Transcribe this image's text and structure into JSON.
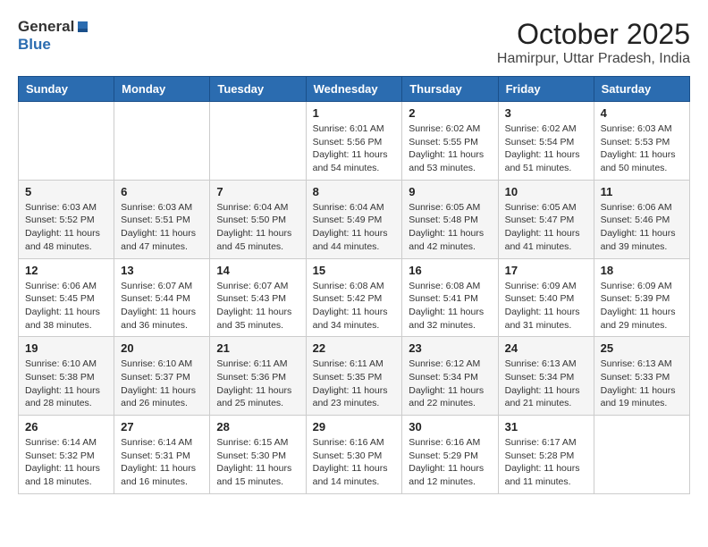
{
  "header": {
    "logo_general": "General",
    "logo_blue": "Blue",
    "month": "October 2025",
    "location": "Hamirpur, Uttar Pradesh, India"
  },
  "days_of_week": [
    "Sunday",
    "Monday",
    "Tuesday",
    "Wednesday",
    "Thursday",
    "Friday",
    "Saturday"
  ],
  "weeks": [
    {
      "days": [
        {
          "date": "",
          "info": ""
        },
        {
          "date": "",
          "info": ""
        },
        {
          "date": "",
          "info": ""
        },
        {
          "date": "1",
          "info": "Sunrise: 6:01 AM\nSunset: 5:56 PM\nDaylight: 11 hours and 54 minutes."
        },
        {
          "date": "2",
          "info": "Sunrise: 6:02 AM\nSunset: 5:55 PM\nDaylight: 11 hours and 53 minutes."
        },
        {
          "date": "3",
          "info": "Sunrise: 6:02 AM\nSunset: 5:54 PM\nDaylight: 11 hours and 51 minutes."
        },
        {
          "date": "4",
          "info": "Sunrise: 6:03 AM\nSunset: 5:53 PM\nDaylight: 11 hours and 50 minutes."
        }
      ]
    },
    {
      "days": [
        {
          "date": "5",
          "info": "Sunrise: 6:03 AM\nSunset: 5:52 PM\nDaylight: 11 hours and 48 minutes."
        },
        {
          "date": "6",
          "info": "Sunrise: 6:03 AM\nSunset: 5:51 PM\nDaylight: 11 hours and 47 minutes."
        },
        {
          "date": "7",
          "info": "Sunrise: 6:04 AM\nSunset: 5:50 PM\nDaylight: 11 hours and 45 minutes."
        },
        {
          "date": "8",
          "info": "Sunrise: 6:04 AM\nSunset: 5:49 PM\nDaylight: 11 hours and 44 minutes."
        },
        {
          "date": "9",
          "info": "Sunrise: 6:05 AM\nSunset: 5:48 PM\nDaylight: 11 hours and 42 minutes."
        },
        {
          "date": "10",
          "info": "Sunrise: 6:05 AM\nSunset: 5:47 PM\nDaylight: 11 hours and 41 minutes."
        },
        {
          "date": "11",
          "info": "Sunrise: 6:06 AM\nSunset: 5:46 PM\nDaylight: 11 hours and 39 minutes."
        }
      ]
    },
    {
      "days": [
        {
          "date": "12",
          "info": "Sunrise: 6:06 AM\nSunset: 5:45 PM\nDaylight: 11 hours and 38 minutes."
        },
        {
          "date": "13",
          "info": "Sunrise: 6:07 AM\nSunset: 5:44 PM\nDaylight: 11 hours and 36 minutes."
        },
        {
          "date": "14",
          "info": "Sunrise: 6:07 AM\nSunset: 5:43 PM\nDaylight: 11 hours and 35 minutes."
        },
        {
          "date": "15",
          "info": "Sunrise: 6:08 AM\nSunset: 5:42 PM\nDaylight: 11 hours and 34 minutes."
        },
        {
          "date": "16",
          "info": "Sunrise: 6:08 AM\nSunset: 5:41 PM\nDaylight: 11 hours and 32 minutes."
        },
        {
          "date": "17",
          "info": "Sunrise: 6:09 AM\nSunset: 5:40 PM\nDaylight: 11 hours and 31 minutes."
        },
        {
          "date": "18",
          "info": "Sunrise: 6:09 AM\nSunset: 5:39 PM\nDaylight: 11 hours and 29 minutes."
        }
      ]
    },
    {
      "days": [
        {
          "date": "19",
          "info": "Sunrise: 6:10 AM\nSunset: 5:38 PM\nDaylight: 11 hours and 28 minutes."
        },
        {
          "date": "20",
          "info": "Sunrise: 6:10 AM\nSunset: 5:37 PM\nDaylight: 11 hours and 26 minutes."
        },
        {
          "date": "21",
          "info": "Sunrise: 6:11 AM\nSunset: 5:36 PM\nDaylight: 11 hours and 25 minutes."
        },
        {
          "date": "22",
          "info": "Sunrise: 6:11 AM\nSunset: 5:35 PM\nDaylight: 11 hours and 23 minutes."
        },
        {
          "date": "23",
          "info": "Sunrise: 6:12 AM\nSunset: 5:34 PM\nDaylight: 11 hours and 22 minutes."
        },
        {
          "date": "24",
          "info": "Sunrise: 6:13 AM\nSunset: 5:34 PM\nDaylight: 11 hours and 21 minutes."
        },
        {
          "date": "25",
          "info": "Sunrise: 6:13 AM\nSunset: 5:33 PM\nDaylight: 11 hours and 19 minutes."
        }
      ]
    },
    {
      "days": [
        {
          "date": "26",
          "info": "Sunrise: 6:14 AM\nSunset: 5:32 PM\nDaylight: 11 hours and 18 minutes."
        },
        {
          "date": "27",
          "info": "Sunrise: 6:14 AM\nSunset: 5:31 PM\nDaylight: 11 hours and 16 minutes."
        },
        {
          "date": "28",
          "info": "Sunrise: 6:15 AM\nSunset: 5:30 PM\nDaylight: 11 hours and 15 minutes."
        },
        {
          "date": "29",
          "info": "Sunrise: 6:16 AM\nSunset: 5:30 PM\nDaylight: 11 hours and 14 minutes."
        },
        {
          "date": "30",
          "info": "Sunrise: 6:16 AM\nSunset: 5:29 PM\nDaylight: 11 hours and 12 minutes."
        },
        {
          "date": "31",
          "info": "Sunrise: 6:17 AM\nSunset: 5:28 PM\nDaylight: 11 hours and 11 minutes."
        },
        {
          "date": "",
          "info": ""
        }
      ]
    }
  ]
}
